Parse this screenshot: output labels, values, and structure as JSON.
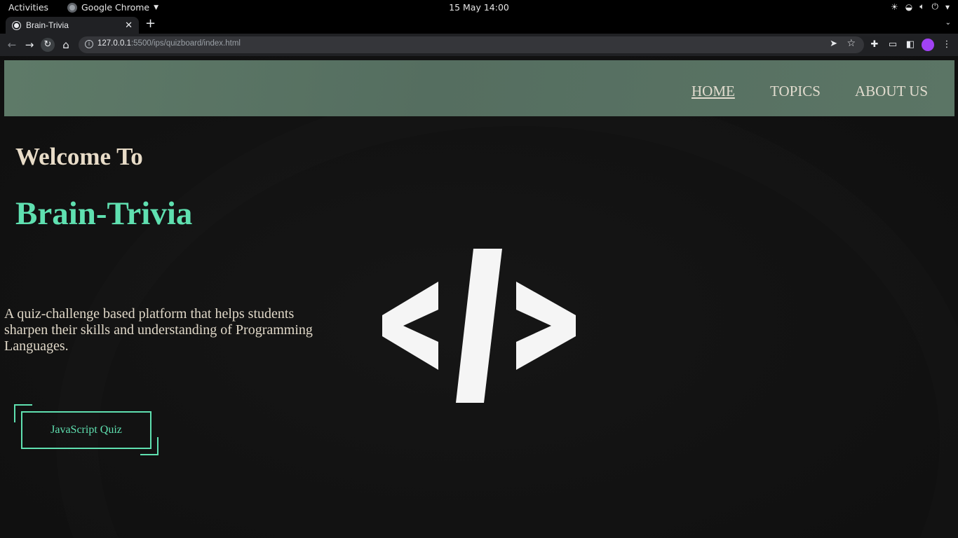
{
  "system_bar": {
    "activities": "Activities",
    "app_name": "Google Chrome",
    "clock": "15 May  14:00",
    "tray_icons": [
      "brightness-icon",
      "wifi-icon",
      "volume-icon",
      "power-icon",
      "chevron-down-icon"
    ]
  },
  "browser": {
    "tab_title": "Brain-Trivia",
    "new_tab": "+",
    "url_host": "127.0.0.1",
    "url_path": ":5500/ips/quizboard/index.html"
  },
  "page": {
    "nav": {
      "home": "HOME",
      "topics": "TOPICS",
      "about": "ABOUT US"
    },
    "welcome": "Welcome To",
    "brand": "Brain-Trivia",
    "tagline": "A quiz-challenge based platform that helps students sharpen their skills and understanding of Programming Languages.",
    "quiz_button": "JavaScript Quiz",
    "colors": {
      "accent": "#5fe0b0",
      "navbar": "#5a7364",
      "background": "#121212",
      "text": "#e8dcc8"
    }
  }
}
